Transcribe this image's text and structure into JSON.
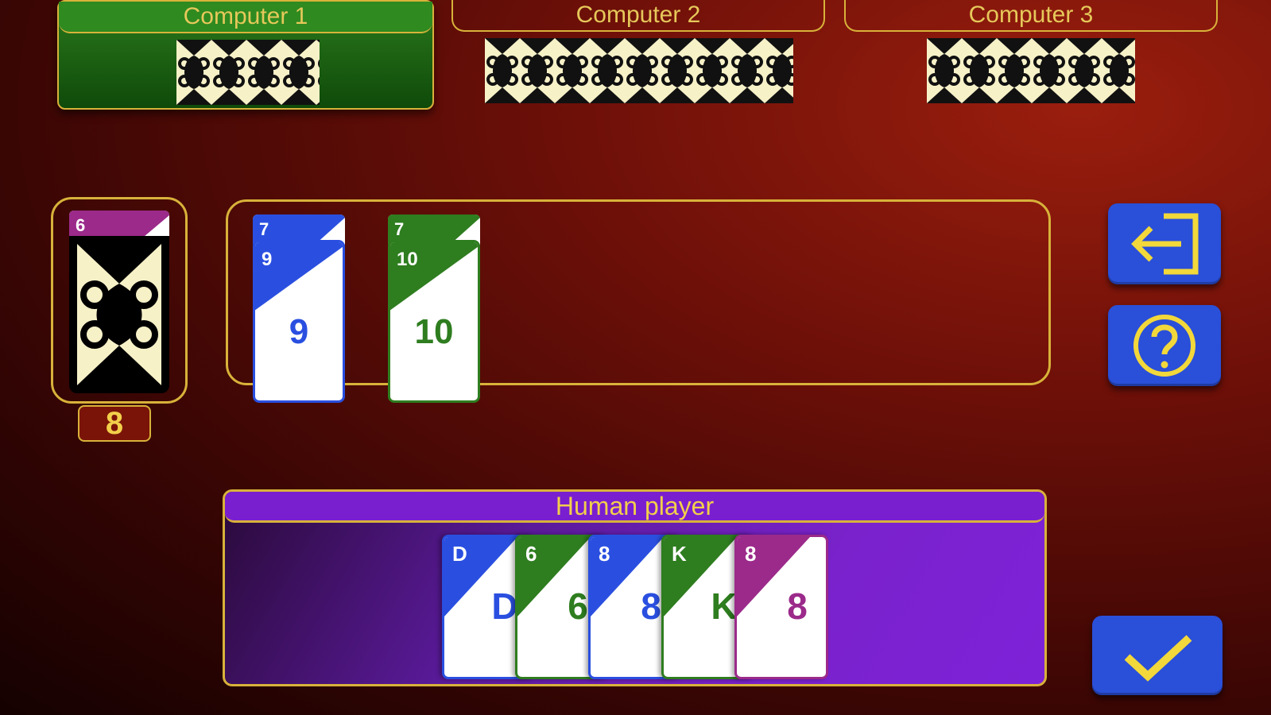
{
  "opponents": [
    {
      "name": "Computer 1",
      "active": true
    },
    {
      "name": "Computer 2",
      "active": false
    },
    {
      "name": "Computer 3",
      "active": false
    }
  ],
  "deck": {
    "count": "8",
    "top_card_rank": "6",
    "top_card_color": "#9b2a8a"
  },
  "table": {
    "piles": [
      {
        "under_rank": "7",
        "rank": "9",
        "color": "#2a4fe0"
      },
      {
        "under_rank": "7",
        "rank": "10",
        "color": "#2e7d1f"
      }
    ]
  },
  "human": {
    "name": "Human player",
    "cards": [
      {
        "rank": "D",
        "color": "#2a4fe0"
      },
      {
        "rank": "6",
        "color": "#2e7d1f"
      },
      {
        "rank": "8",
        "color": "#2a4fe0"
      },
      {
        "rank": "K",
        "color": "#2e7d1f"
      },
      {
        "rank": "8",
        "color": "#9b2a8a"
      }
    ]
  },
  "colors": {
    "gold": "#d8b23a",
    "button": "#2a4fd8",
    "felt_red": "#6b0f08",
    "human_purple": "#7a1fd0",
    "active_green": "#2b7a1c"
  },
  "icons": {
    "exit": "exit-icon",
    "help": "help-icon",
    "confirm": "checkmark-icon",
    "card_back": "card-back-pattern"
  }
}
